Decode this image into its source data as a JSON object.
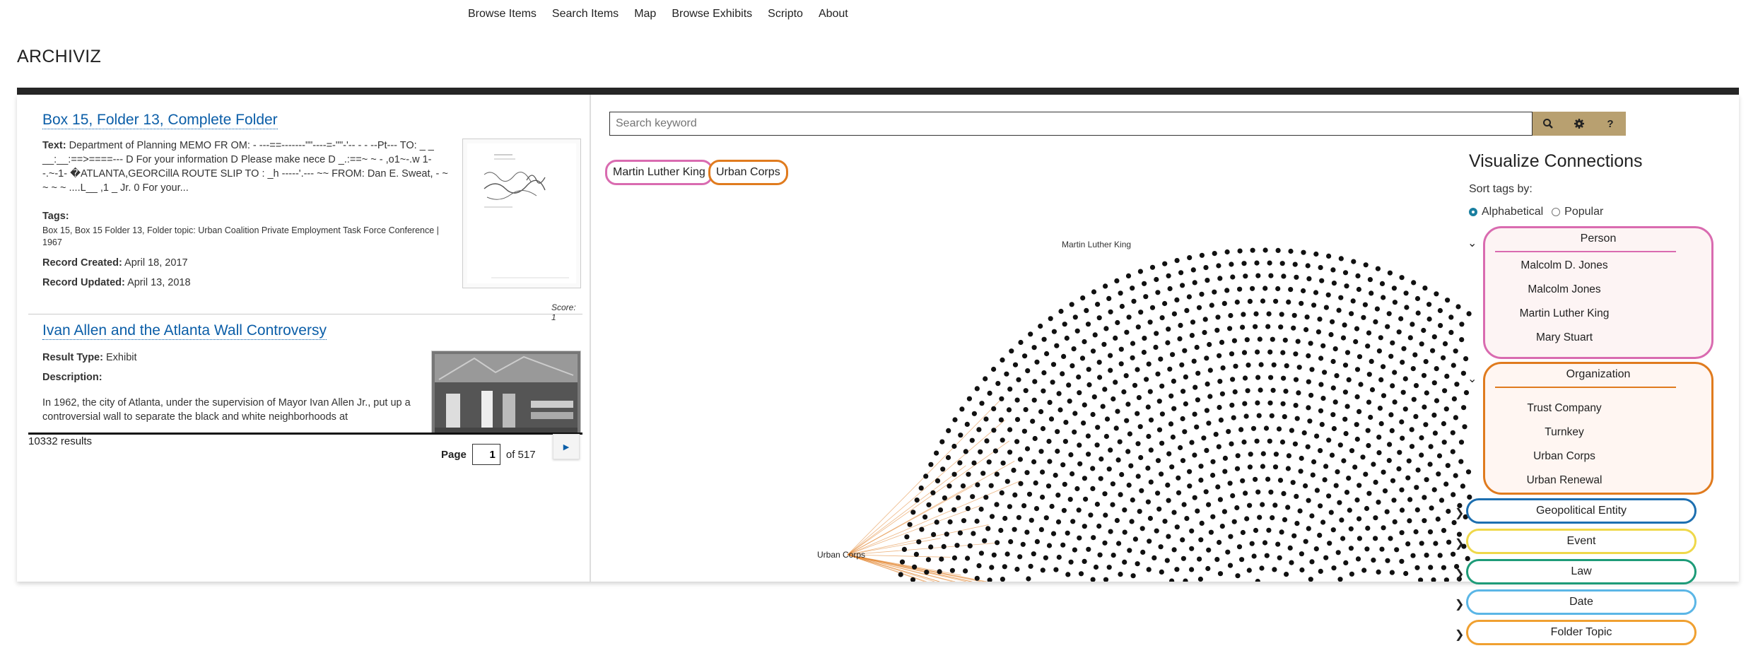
{
  "nav": [
    "Browse Items",
    "Search Items",
    "Map",
    "Browse Exhibits",
    "Scripto",
    "About"
  ],
  "brand": "ARCHIVIZ",
  "result1": {
    "title": "Box 15, Folder 13, Complete Folder",
    "text_label": "Text:",
    "text": "Department of Planning MEMO FR OM: - ---==-------\"\"----=-\"\"-'-- - - --Pt--- TO: _ _ __:__:==>====--- D For your information D Please make nece D _.:==~ ~ - ,o1~-.w 1--.~-1- �ATLANTA,GEORCillA ROUTE SLIP TO : _h -----'.--- ~~ FROM: Dan E. Sweat, - ~ ~ ~ ~ ....L__ ,1 _ Jr. 0 For your...",
    "tags_label": "Tags:",
    "tags": "Box 15, Box 15 Folder 13, Folder topic: Urban Coalition Private Employment Task Force Conference | 1967",
    "created_label": "Record Created:",
    "created": "April 18, 2017",
    "updated_label": "Record Updated:",
    "updated": "April 13, 2018",
    "score": "Score: 1"
  },
  "result2": {
    "title": "Ivan Allen and the Atlanta Wall Controversy",
    "type_label": "Result Type:",
    "type": "Exhibit",
    "desc_label": "Description:",
    "desc": "In 1962, the city of Atlanta, under the supervision of Mayor Ivan Allen Jr., put up a controversial wall to separate the black and white neighborhoods at"
  },
  "results_count": "10332 results",
  "pager": {
    "label": "Page",
    "value": "1",
    "of": "of 517"
  },
  "search": {
    "placeholder": "Search keyword"
  },
  "chips": [
    "Martin Luther King",
    "Urban Corps"
  ],
  "viz_labels": {
    "top": "Martin Luther King",
    "left": "Urban Corps"
  },
  "sidebar": {
    "title": "Visualize Connections",
    "sort_label": "Sort tags by:",
    "sort_options": [
      "Alphabetical",
      "Popular"
    ],
    "sort_selected": "Alphabetical",
    "person": {
      "header": "Person",
      "items": [
        "Malcolm D. Jones",
        "Malcolm Jones",
        "Martin Luther King",
        "Mary Stuart"
      ]
    },
    "organization": {
      "header": "Organization",
      "items": [
        "Trust Company",
        "Turnkey",
        "Urban Corps",
        "Urban Renewal"
      ]
    },
    "collapsed": [
      "Geopolitical Entity",
      "Event",
      "Law",
      "Date",
      "Folder Topic"
    ]
  },
  "colors": {
    "person": "#d96bb0",
    "organization": "#e07b1e",
    "geopolitical": "#1d6fb0",
    "event": "#efd84a",
    "law": "#1d9b78",
    "date": "#5bb6e6",
    "folder_topic": "#f0a030",
    "accent": "#b8a070"
  }
}
